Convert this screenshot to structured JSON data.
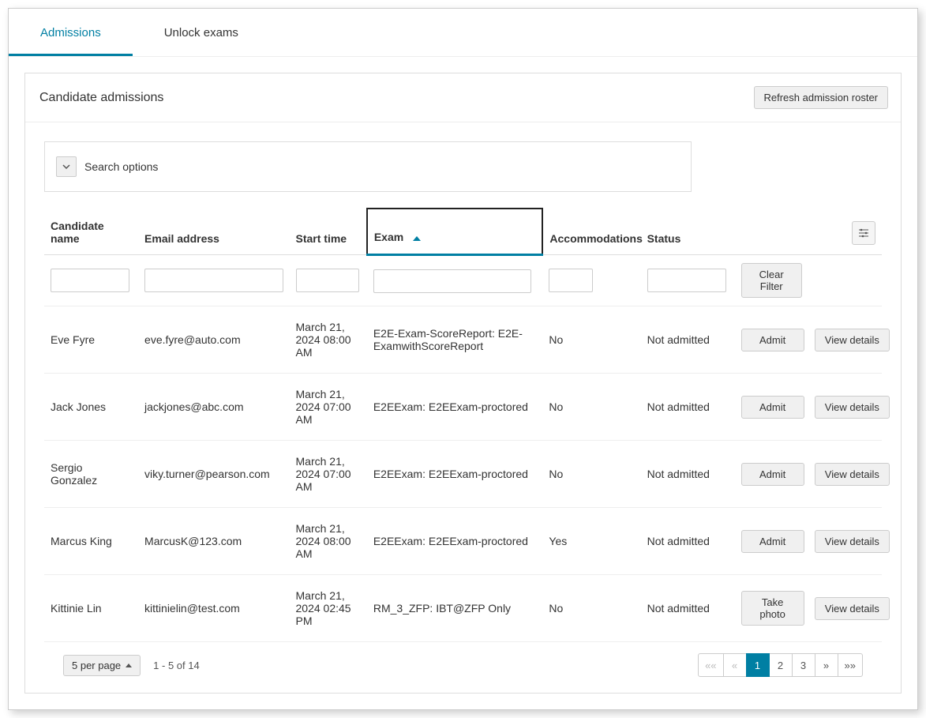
{
  "tabs": [
    {
      "label": "Admissions",
      "active": true
    },
    {
      "label": "Unlock exams",
      "active": false
    }
  ],
  "panel": {
    "title": "Candidate admissions",
    "refresh_label": "Refresh admission roster",
    "search_options_label": "Search options"
  },
  "columns": {
    "name": "Candidate name",
    "email": "Email address",
    "start": "Start time",
    "exam": "Exam",
    "accom": "Accommodations",
    "status": "Status"
  },
  "filter": {
    "clear_label": "Clear Filter"
  },
  "rows": [
    {
      "name": "Eve Fyre",
      "email": "eve.fyre@auto.com",
      "start": "March 21, 2024 08:00 AM",
      "exam": "E2E-Exam-ScoreReport: E2E-ExamwithScoreReport",
      "accom": "No",
      "status": "Not admitted",
      "action1": "Admit",
      "action2": "View details"
    },
    {
      "name": "Jack Jones",
      "email": "jackjones@abc.com",
      "start": "March 21, 2024 07:00 AM",
      "exam": "E2EExam: E2EExam-proctored",
      "accom": "No",
      "status": "Not admitted",
      "action1": "Admit",
      "action2": "View details"
    },
    {
      "name": "Sergio Gonzalez",
      "email": "viky.turner@pearson.com",
      "start": "March 21, 2024 07:00 AM",
      "exam": "E2EExam: E2EExam-proctored",
      "accom": "No",
      "status": "Not admitted",
      "action1": "Admit",
      "action2": "View details"
    },
    {
      "name": "Marcus King",
      "email": "MarcusK@123.com",
      "start": "March 21, 2024 08:00 AM",
      "exam": "E2EExam: E2EExam-proctored",
      "accom": "Yes",
      "status": "Not admitted",
      "action1": "Admit",
      "action2": "View details"
    },
    {
      "name": "Kittinie Lin",
      "email": "kittinielin@test.com",
      "start": "March 21, 2024 02:45 PM",
      "exam": "RM_3_ZFP: IBT@ZFP Only",
      "accom": "No",
      "status": "Not admitted",
      "action1": "Take photo",
      "action2": "View details"
    }
  ],
  "pager": {
    "per_page_label": "5 per page",
    "range_text": "1 - 5 of 14",
    "first": "««",
    "prev": "«",
    "pages": [
      "1",
      "2",
      "3"
    ],
    "next": "»",
    "last": "»»",
    "active_page": "1"
  }
}
